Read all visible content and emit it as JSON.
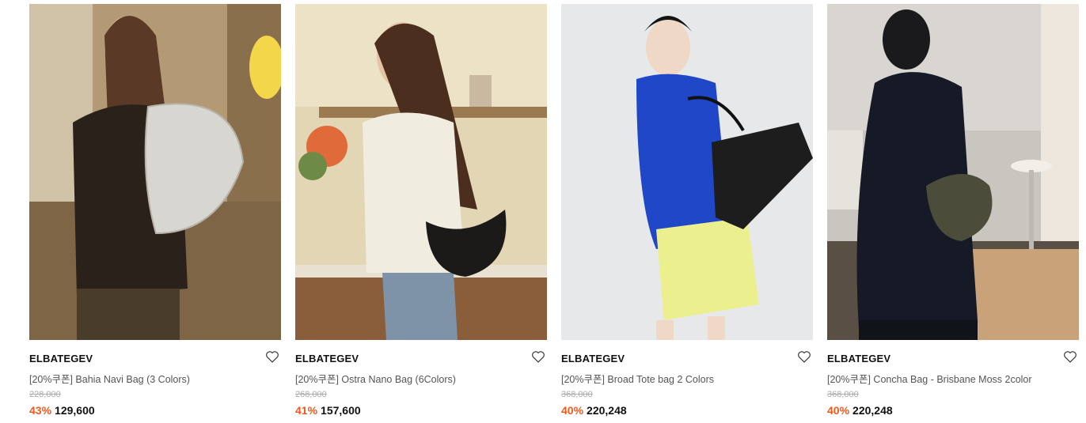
{
  "products": [
    {
      "brand": "ELBATEGEV",
      "title": "[20%쿠폰] Bahia Navi Bag (3 Colors)",
      "original_price": "228,000",
      "discount": "43%",
      "price": "129,600",
      "image_name": "product-image-bahia-navi-bag"
    },
    {
      "brand": "ELBATEGEV",
      "title": "[20%쿠폰] Ostra Nano Bag (6Colors)",
      "original_price": "268,000",
      "discount": "41%",
      "price": "157,600",
      "image_name": "product-image-ostra-nano-bag"
    },
    {
      "brand": "ELBATEGEV",
      "title": "[20%쿠폰] Broad Tote bag 2 Colors",
      "original_price": "368,000",
      "discount": "40%",
      "price": "220,248",
      "image_name": "product-image-broad-tote-bag"
    },
    {
      "brand": "ELBATEGEV",
      "title": "[20%쿠폰] Concha Bag - Brisbane Moss 2color",
      "original_price": "368,000",
      "discount": "40%",
      "price": "220,248",
      "image_name": "product-image-concha-bag"
    }
  ],
  "colors": {
    "discount": "#ef5a1f",
    "brand_text": "#111111",
    "title_text": "#555555",
    "original_price": "#aaaaaa"
  },
  "icons": {
    "wishlist": "heart-icon"
  }
}
